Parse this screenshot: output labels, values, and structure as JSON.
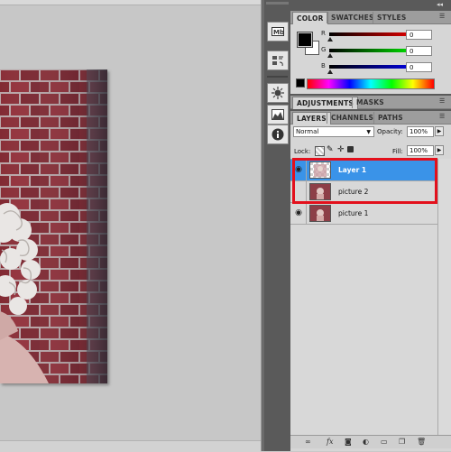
{
  "colors": {
    "selected_row": "#3a93e8",
    "highlight": "#e3101c",
    "foreground_swatch": "#000000",
    "background_swatch": "#ffffff"
  },
  "icon_dock": [
    "mini-bridge-icon",
    "layer-comps-icon",
    "adjustments-icon",
    "histogram-icon",
    "info-icon"
  ],
  "color_panel": {
    "tabs": [
      "COLOR",
      "SWATCHES",
      "STYLES"
    ],
    "channels": [
      {
        "label": "R",
        "value": "0"
      },
      {
        "label": "G",
        "value": "0"
      },
      {
        "label": "B",
        "value": "0"
      }
    ]
  },
  "adjust_panel": {
    "tabs": [
      "ADJUSTMENTS",
      "MASKS"
    ]
  },
  "layers_panel": {
    "tabs": [
      "LAYERS",
      "CHANNELS",
      "PATHS"
    ],
    "blend_mode": "Normal",
    "opacity_label": "Opacity:",
    "opacity_value": "100%",
    "lock_label": "Lock:",
    "fill_label": "Fill:",
    "fill_value": "100%",
    "layers": [
      {
        "name": "Layer 1",
        "visible": true,
        "selected": true
      },
      {
        "name": "picture 2",
        "visible": false,
        "selected": false
      },
      {
        "name": "picture 1",
        "visible": true,
        "selected": false
      }
    ]
  }
}
